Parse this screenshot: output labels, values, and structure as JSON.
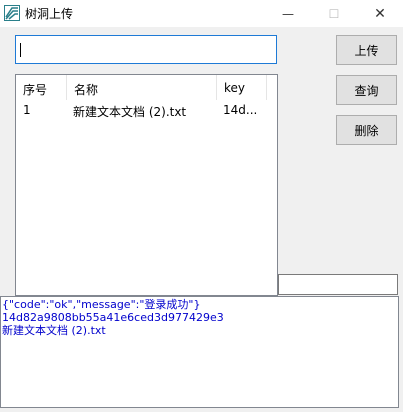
{
  "window": {
    "title": "树洞上传",
    "minimize_symbol": "—",
    "maximize_symbol": "☐",
    "close_symbol": "✕"
  },
  "input": {
    "value": "",
    "placeholder": ""
  },
  "buttons": {
    "upload": "上传",
    "query": "查询",
    "delete": "删除"
  },
  "list": {
    "columns": [
      "序号",
      "名称",
      "key"
    ],
    "rows": [
      [
        "1",
        "新建文本文档 (2).txt",
        "14d..."
      ]
    ]
  },
  "small_input": {
    "value": ""
  },
  "output": {
    "lines": [
      "{\"code\":\"ok\",\"message\":\"登录成功\"}",
      "14d82a9808bb55a41e6ced3d977429e3",
      "新建文本文档 (2).txt"
    ]
  }
}
